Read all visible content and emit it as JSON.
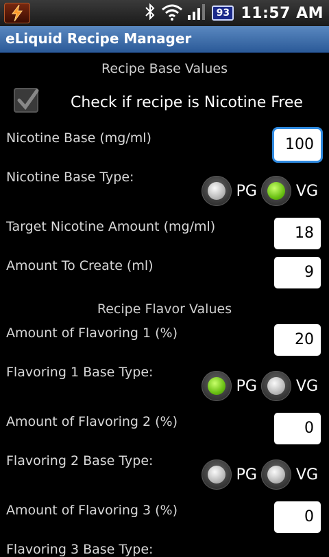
{
  "status": {
    "battery": "93",
    "time": "11:57 AM"
  },
  "app": {
    "title": "eLiquid Recipe Manager"
  },
  "sections": {
    "base": "Recipe Base Values",
    "flavor": "Recipe Flavor Values"
  },
  "nicotine_free": {
    "label": "Check if recipe is Nicotine Free",
    "checked": true
  },
  "fields": {
    "nicotine_base": {
      "label": "Nicotine Base (mg/ml)",
      "value": "100"
    },
    "nicotine_base_type": {
      "label": "Nicotine Base Type:",
      "pg": "PG",
      "vg": "VG",
      "selected": "VG"
    },
    "target_nicotine": {
      "label": "Target Nicotine Amount (mg/ml)",
      "value": "18"
    },
    "amount_to_create": {
      "label": "Amount To Create (ml)",
      "value": "9"
    },
    "flavor1": {
      "label": "Amount of Flavoring 1 (%)",
      "value": "20"
    },
    "flavor1_type": {
      "label": "Flavoring 1 Base Type:",
      "pg": "PG",
      "vg": "VG",
      "selected": "PG"
    },
    "flavor2": {
      "label": "Amount of Flavoring 2 (%)",
      "value": "0"
    },
    "flavor2_type": {
      "label": "Flavoring 2 Base Type:",
      "pg": "PG",
      "vg": "VG",
      "selected": "none"
    },
    "flavor3": {
      "label": "Amount of Flavoring 3 (%)",
      "value": "0"
    },
    "flavor3_type": {
      "label": "Flavoring 3 Base Type:"
    }
  },
  "colors": {
    "titlebar": "#2b5a98",
    "radio_on": "#6ac014",
    "focus": "#2f8ae0"
  }
}
